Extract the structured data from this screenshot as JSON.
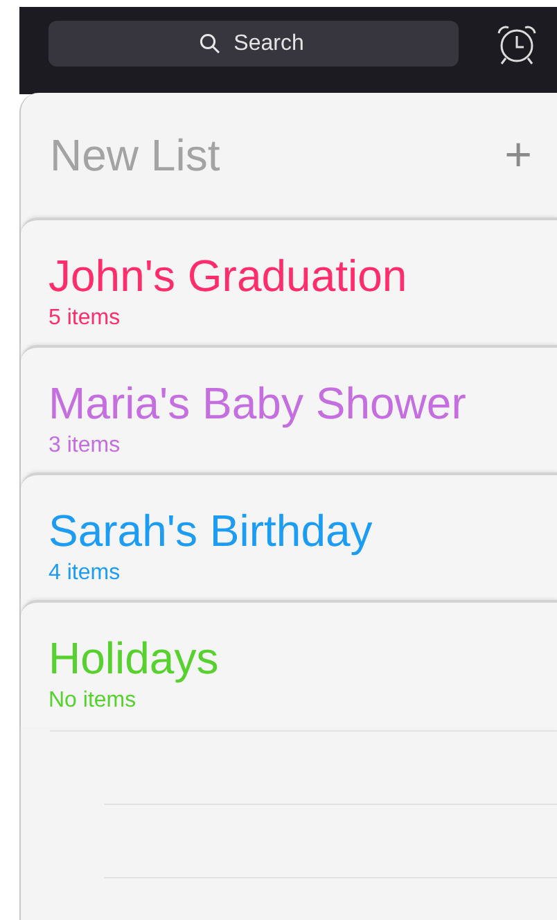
{
  "search": {
    "placeholder": "Search"
  },
  "new_list": {
    "label": "New List",
    "add": "+"
  },
  "lists": [
    {
      "title": "John's Graduation",
      "count": "5 items",
      "color": "#ff2d6b"
    },
    {
      "title": "Maria's Baby Shower",
      "count": "3 items",
      "color": "#c46ee0"
    },
    {
      "title": "Sarah's Birthday",
      "count": "4 items",
      "color": "#1d9cf3"
    },
    {
      "title": "Holidays",
      "count": "No items",
      "color": "#56d12e"
    }
  ]
}
